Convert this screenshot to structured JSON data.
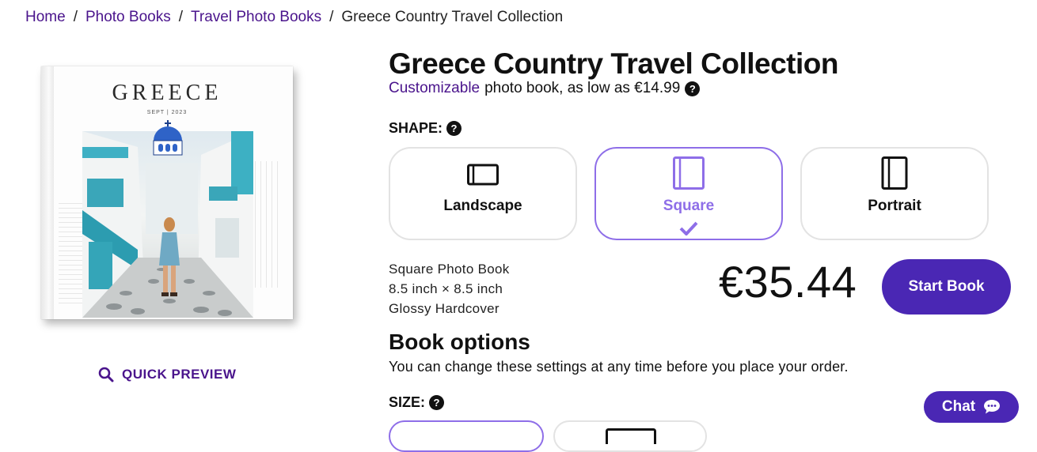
{
  "breadcrumb": {
    "items": [
      "Home",
      "Photo Books",
      "Travel Photo Books"
    ],
    "current": "Greece Country Travel Collection"
  },
  "product": {
    "title": "Greece Country Travel Collection",
    "subtitle_link": "Customizable",
    "subtitle_rest": "photo book, as low as €14.99",
    "cover_title": "GREECE",
    "cover_date": "SEPT | 2023"
  },
  "quick_preview": {
    "label": "QUICK PREVIEW",
    "icon": "search-icon"
  },
  "shape": {
    "label": "SHAPE:",
    "options": [
      {
        "label": "Landscape",
        "icon": "landscape-book-icon",
        "selected": false
      },
      {
        "label": "Square",
        "icon": "square-book-icon",
        "selected": true
      },
      {
        "label": "Portrait",
        "icon": "portrait-book-icon",
        "selected": false
      }
    ]
  },
  "specs": [
    "Square Photo Book",
    "8.5 inch × 8.5 inch",
    "Glossy Hardcover"
  ],
  "price": "€35.44",
  "start_button": "Start Book",
  "book_options": {
    "title": "Book options",
    "description": "You can change these settings at any time before you place your order."
  },
  "size": {
    "label": "SIZE:"
  },
  "chat": {
    "label": "Chat",
    "icon": "chat-bubble-icon"
  },
  "colors": {
    "accent": "#4a148c",
    "button": "#4a27b4",
    "selected_border": "#8e6ee8"
  }
}
